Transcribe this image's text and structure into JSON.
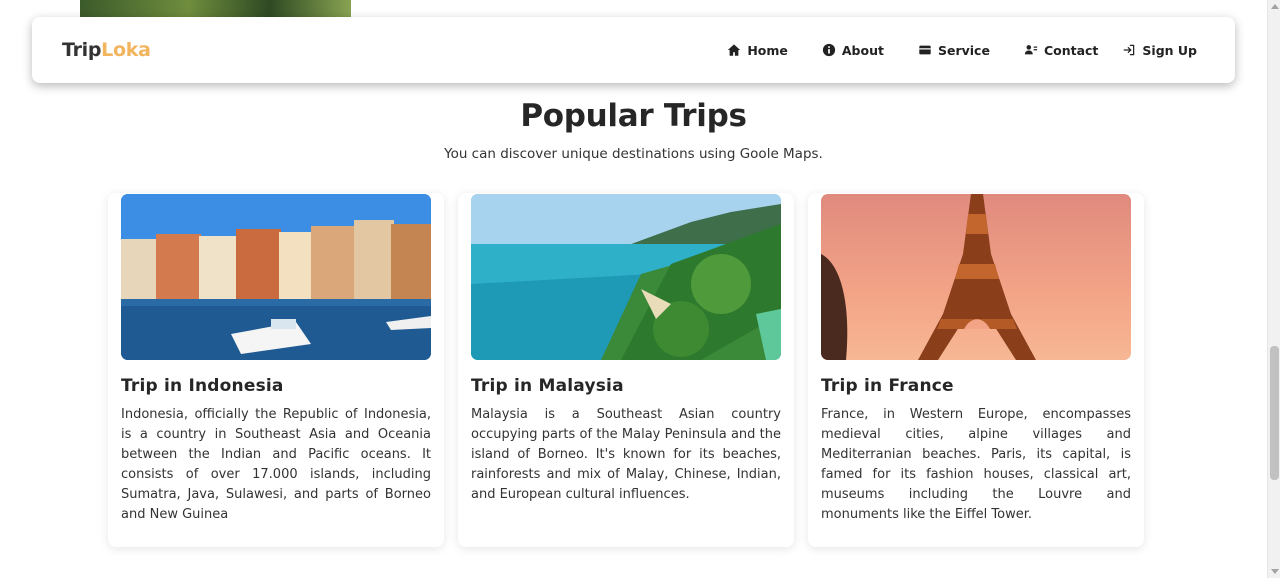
{
  "brand": {
    "part1": "Trip",
    "part2": "Loka"
  },
  "nav": [
    {
      "label": "Home",
      "icon": "home-icon"
    },
    {
      "label": "About",
      "icon": "info-icon"
    },
    {
      "label": "Service",
      "icon": "service-icon"
    },
    {
      "label": "Contact",
      "icon": "contact-icon"
    },
    {
      "label": "Sign Up",
      "icon": "sign-in-icon"
    }
  ],
  "section": {
    "title": "Popular Trips",
    "subtitle": "You can discover unique destinations using Goole Maps."
  },
  "cards": [
    {
      "title": "Trip in Indonesia",
      "text": "Indonesia, officially the Republic of Indonesia, is a country in Southeast Asia and Oceania between the Indian and Pacific oceans. It consists of over 17.000 islands, including Sumatra, Java, Sulawesi, and parts of Borneo and New Guinea"
    },
    {
      "title": "Trip in Malaysia",
      "text": "Malaysia is a Southeast Asian country occupying parts of the Malay Peninsula and the island of Borneo. It's known for its beaches, rainforests and mix of Malay, Chinese, Indian, and European cultural influences."
    },
    {
      "title": "Trip in France",
      "text": "France, in Western Europe, encompasses medieval cities, alpine villages and Mediterranian beaches. Paris, its capital, is famed for its fashion houses, classical art, museums including the Louvre and monuments like the Eiffel Tower."
    }
  ],
  "colors": {
    "brand_accent": "#f2b45c",
    "text": "#262626"
  }
}
